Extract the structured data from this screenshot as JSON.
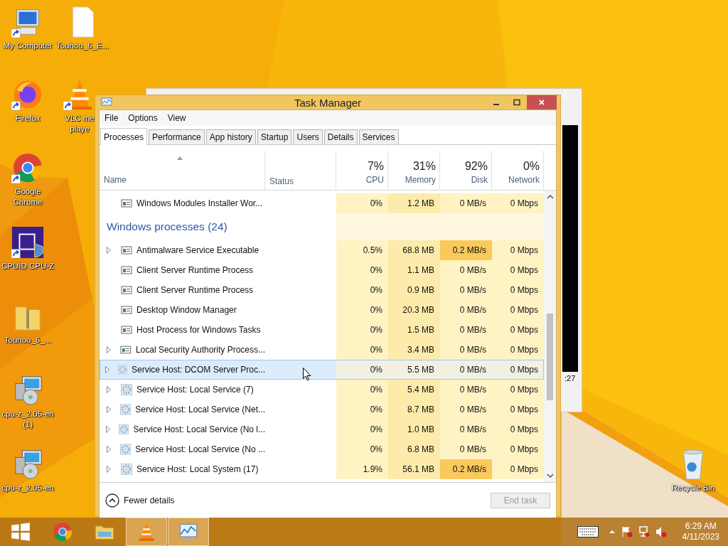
{
  "desktop_icons": [
    {
      "kind": "computer",
      "lines": [
        "My Computer"
      ],
      "shortcut": true
    },
    {
      "kind": "file",
      "lines": [
        "Touhou_6_E..."
      ],
      "shortcut": false
    },
    {
      "kind": "firefox",
      "lines": [
        "Firefox"
      ],
      "shortcut": true
    },
    {
      "kind": "vlc",
      "lines": [
        "VLC me",
        "playe"
      ],
      "shortcut": true
    },
    {
      "kind": "chrome",
      "lines": [
        "Google",
        "Chrome"
      ],
      "shortcut": true
    },
    {
      "kind": "cpuz",
      "lines": [
        "CPUID CPU-Z"
      ],
      "shortcut": true
    },
    {
      "kind": "zip",
      "lines": [
        "Touhou_6_..."
      ],
      "shortcut": false
    },
    {
      "kind": "installer",
      "lines": [
        "cpu-z_2.05-en",
        "(1)"
      ],
      "shortcut": false
    },
    {
      "kind": "installer",
      "lines": [
        "cpu-z_2.05-en"
      ],
      "shortcut": false
    },
    {
      "kind": "recycle",
      "lines": [
        "Recycle Bin"
      ],
      "shortcut": false
    }
  ],
  "behind_window": {
    "text": ":27"
  },
  "window": {
    "title": "Task Manager"
  },
  "menu": [
    "File",
    "Options",
    "View"
  ],
  "tabs": [
    {
      "label": "Processes",
      "selected": true
    },
    {
      "label": "Performance",
      "selected": false
    },
    {
      "label": "App history",
      "selected": false
    },
    {
      "label": "Startup",
      "selected": false
    },
    {
      "label": "Users",
      "selected": false
    },
    {
      "label": "Details",
      "selected": false
    },
    {
      "label": "Services",
      "selected": false
    }
  ],
  "columns": {
    "name": "Name",
    "status": "Status",
    "metrics": [
      {
        "percent": "7%",
        "label": "CPU"
      },
      {
        "percent": "31%",
        "label": "Memory"
      },
      {
        "percent": "92%",
        "label": "Disk"
      },
      {
        "percent": "0%",
        "label": "Network"
      }
    ]
  },
  "rows": [
    {
      "kind": "app",
      "name": "Windows Modules Installer Wor...",
      "expandable": false,
      "selected": false,
      "values": [
        "0%",
        "1.2 MB",
        "0 MB/s",
        "0 Mbps"
      ],
      "hot": [
        false,
        false,
        false,
        false
      ]
    },
    {
      "kind": "group",
      "name": "Windows processes (24)"
    },
    {
      "kind": "app",
      "name": "Antimalware Service Executable",
      "expandable": true,
      "selected": false,
      "values": [
        "0.5%",
        "68.8 MB",
        "0.2 MB/s",
        "0 Mbps"
      ],
      "hot": [
        false,
        false,
        true,
        false
      ]
    },
    {
      "kind": "app",
      "name": "Client Server Runtime Process",
      "expandable": false,
      "selected": false,
      "values": [
        "0%",
        "1.1 MB",
        "0 MB/s",
        "0 Mbps"
      ],
      "hot": [
        false,
        false,
        false,
        false
      ]
    },
    {
      "kind": "app",
      "name": "Client Server Runtime Process",
      "expandable": false,
      "selected": false,
      "values": [
        "0%",
        "0.9 MB",
        "0 MB/s",
        "0 Mbps"
      ],
      "hot": [
        false,
        false,
        false,
        false
      ]
    },
    {
      "kind": "app",
      "name": "Desktop Window Manager",
      "expandable": false,
      "selected": false,
      "values": [
        "0%",
        "20.3 MB",
        "0 MB/s",
        "0 Mbps"
      ],
      "hot": [
        false,
        false,
        false,
        false
      ]
    },
    {
      "kind": "app",
      "name": "Host Process for Windows Tasks",
      "expandable": false,
      "selected": false,
      "values": [
        "0%",
        "1.5 MB",
        "0 MB/s",
        "0 Mbps"
      ],
      "hot": [
        false,
        false,
        false,
        false
      ]
    },
    {
      "kind": "app",
      "name": "Local Security Authority Process...",
      "expandable": true,
      "selected": false,
      "values": [
        "0%",
        "3.4 MB",
        "0 MB/s",
        "0 Mbps"
      ],
      "hot": [
        false,
        false,
        false,
        false
      ]
    },
    {
      "kind": "service",
      "name": "Service Host: DCOM Server Proc...",
      "expandable": true,
      "selected": true,
      "values": [
        "0%",
        "5.5 MB",
        "0 MB/s",
        "0 Mbps"
      ],
      "hot": [
        false,
        false,
        false,
        false
      ]
    },
    {
      "kind": "service",
      "name": "Service Host: Local Service (7)",
      "expandable": true,
      "selected": false,
      "values": [
        "0%",
        "5.4 MB",
        "0 MB/s",
        "0 Mbps"
      ],
      "hot": [
        false,
        false,
        false,
        false
      ]
    },
    {
      "kind": "service",
      "name": "Service Host: Local Service (Net...",
      "expandable": true,
      "selected": false,
      "values": [
        "0%",
        "8.7 MB",
        "0 MB/s",
        "0 Mbps"
      ],
      "hot": [
        false,
        false,
        false,
        false
      ]
    },
    {
      "kind": "service",
      "name": "Service Host: Local Service (No l...",
      "expandable": true,
      "selected": false,
      "values": [
        "0%",
        "1.0 MB",
        "0 MB/s",
        "0 Mbps"
      ],
      "hot": [
        false,
        false,
        false,
        false
      ]
    },
    {
      "kind": "service",
      "name": "Service Host: Local Service (No ...",
      "expandable": true,
      "selected": false,
      "values": [
        "0%",
        "6.8 MB",
        "0 MB/s",
        "0 Mbps"
      ],
      "hot": [
        false,
        false,
        false,
        false
      ]
    },
    {
      "kind": "service",
      "name": "Service Host: Local System (17)",
      "expandable": true,
      "selected": false,
      "values": [
        "1.9%",
        "56.1 MB",
        "0.2 MB/s",
        "0 Mbps"
      ],
      "hot": [
        false,
        false,
        true,
        false
      ]
    }
  ],
  "footer": {
    "toggle": "Fewer details",
    "end_task": {
      "label": "End task",
      "disabled": true
    }
  },
  "taskbar": {
    "apps": [
      {
        "kind": "start",
        "running": false
      },
      {
        "kind": "chrome",
        "running": false
      },
      {
        "kind": "explorer",
        "running": false
      },
      {
        "kind": "vlc",
        "running": true
      },
      {
        "kind": "taskmgr",
        "running": true
      }
    ],
    "tray": [
      {
        "kind": "keyboard"
      },
      {
        "kind": "caret"
      },
      {
        "kind": "flag"
      },
      {
        "kind": "network"
      },
      {
        "kind": "speaker"
      }
    ],
    "time": "6:29 AM",
    "date": "4/11/2023"
  }
}
